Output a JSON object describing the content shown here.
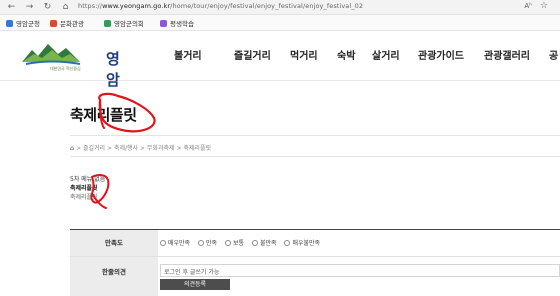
{
  "browser": {
    "url_prefix": "https://",
    "url_host": "www.yeongam.go.kr",
    "url_path": "/home/tour/enjoy/festival/enjoy_festival/enjoy_festival_02",
    "read_aloud": "Aʰ",
    "favorite_icon": "star-icon"
  },
  "bookmarks": [
    {
      "label": "영암군청",
      "color": "#2e7bd6"
    },
    {
      "label": "문화관광",
      "color": "#d64a2e"
    },
    {
      "label": "영암군의회",
      "color": "#2e9e5a"
    },
    {
      "label": "평생학습",
      "color": "#8a5ad6"
    }
  ],
  "site": {
    "logo_name": "영암",
    "logo_slogan": "대한민국 혁신중심",
    "nav": [
      "볼거리",
      "즐길거리",
      "먹거리",
      "숙박",
      "살거리",
      "관광가이드",
      "관광갤러리",
      "공"
    ]
  },
  "page": {
    "title": "축제리플릿",
    "breadcrumb": [
      "즐길거리",
      "축제/행사",
      "무화과축제",
      "축제리플릿"
    ],
    "menu_note": "5차 메뉴 없음",
    "menu_title": "축제리플릿",
    "menu_sub": "축제리플릿"
  },
  "survey": {
    "satisfaction_label": "만족도",
    "options": [
      "매우만족",
      "만족",
      "보통",
      "불만족",
      "매우불만족"
    ],
    "comment_label": "한줄의견",
    "comment_placeholder": "로그인 후 글쓰기 가능",
    "submit_label": "의견등록"
  },
  "colors": {
    "brand": "#1d3f7a",
    "annotation": "#e0141b"
  }
}
